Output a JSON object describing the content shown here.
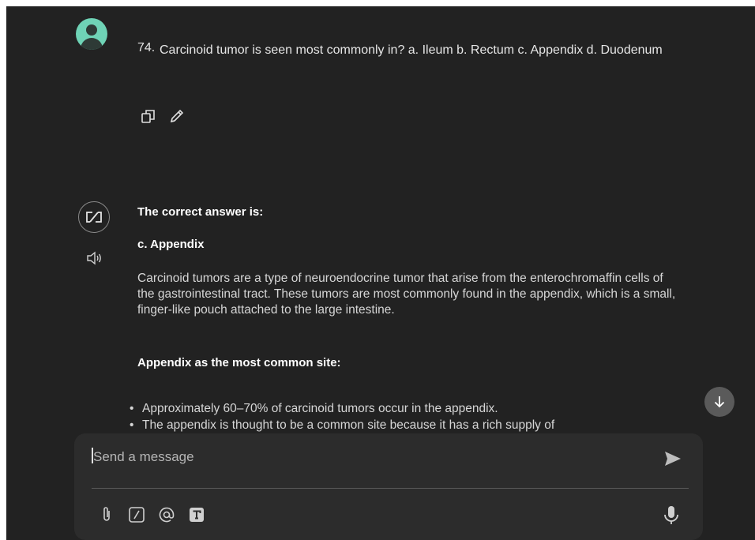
{
  "user_message": {
    "number": "74.",
    "text": "Carcinoid tumor is seen most commonly in? a. Ileum b. Rectum c. Appendix d. Duodenum",
    "actions": [
      {
        "icon": "copy-icon"
      },
      {
        "icon": "edit-pencil-icon"
      }
    ]
  },
  "assistant_message": {
    "heading": "The correct answer is:",
    "answer": "c. Appendix",
    "paragraph": "Carcinoid tumors are a type of neuroendocrine tumor that arise from the enterochromaffin cells of the gastrointestinal tract. These tumors are most commonly found in the appendix, which is a small, finger-like pouch attached to the large intestine.",
    "subheading": "Appendix as the most common site:",
    "bullets": [
      "Approximately 60–70% of carcinoid tumors occur in the appendix.",
      "The appendix is thought to be a common site because it has a rich supply of"
    ]
  },
  "composer": {
    "placeholder": "Send a message",
    "value": "",
    "tools": [
      "attach-icon",
      "slash-command-icon",
      "mention-icon",
      "text-format-icon"
    ]
  },
  "colors": {
    "background": "#222222",
    "composer": "#2c2c2c",
    "avatar": "#6fd3b6",
    "scroll_button": "#5a5a5a"
  }
}
